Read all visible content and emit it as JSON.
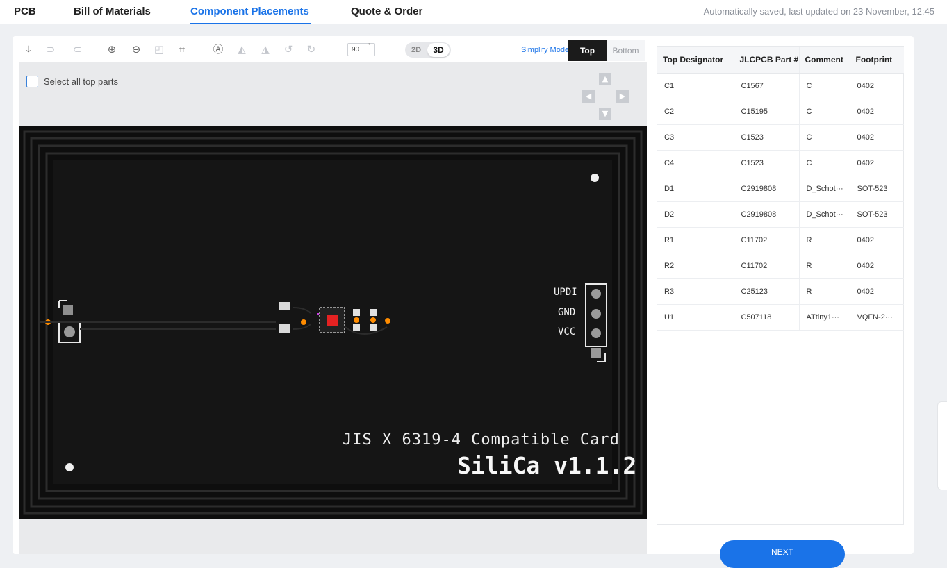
{
  "tabs": [
    {
      "label": "PCB"
    },
    {
      "label": "Bill of Materials"
    },
    {
      "label": "Component Placements"
    },
    {
      "label": "Quote & Order"
    }
  ],
  "save_status": "Automatically saved, last updated on 23 November, 12:45",
  "toolbar": {
    "rotation_value": "90",
    "rotation_unit": "°",
    "view_2d_label": "2D",
    "view_3d_label": "3D",
    "simplify_label": "Simplify Model",
    "top_label": "Top",
    "bottom_label": "Bottom"
  },
  "select_all_label": "Select all top parts",
  "board": {
    "pin_labels": [
      "UPDI",
      "GND",
      "VCC"
    ],
    "silk_line1": "JIS X 6319-4 Compatible Card",
    "silk_line2": "SiliCa v1.1.2",
    "colors": {
      "substrate": "#0e0e0e",
      "silk": "#f0f0f0",
      "pad": "#d9d9d9",
      "accent": "#e52222"
    }
  },
  "table": {
    "headers": [
      "Top Designator",
      "JLCPCB Part #",
      "Comment",
      "Footprint"
    ],
    "rows": [
      [
        "C1",
        "C1567",
        "C",
        "0402"
      ],
      [
        "C2",
        "C15195",
        "C",
        "0402"
      ],
      [
        "C3",
        "C1523",
        "C",
        "0402"
      ],
      [
        "C4",
        "C1523",
        "C",
        "0402"
      ],
      [
        "D1",
        "C2919808",
        "D_Schot···",
        "SOT-523"
      ],
      [
        "D2",
        "C2919808",
        "D_Schot···",
        "SOT-523"
      ],
      [
        "R1",
        "C11702",
        "R",
        "0402"
      ],
      [
        "R2",
        "C11702",
        "R",
        "0402"
      ],
      [
        "R3",
        "C25123",
        "R",
        "0402"
      ],
      [
        "U1",
        "C507118",
        "ATtiny1···",
        "VQFN-2···"
      ]
    ]
  },
  "next_label": "NEXT",
  "accent_color": "#1a73e8"
}
